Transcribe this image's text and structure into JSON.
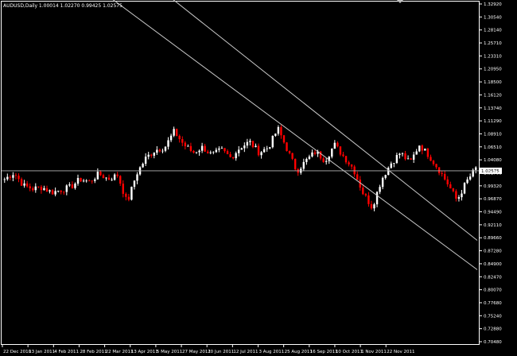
{
  "chart_data": {
    "type": "candlestick",
    "title": "AUDUSD,Daily  1.00014 1.02270 0.99425 1.02575",
    "current_price": "1.02575",
    "ylim": [
      0.7048,
      1.339
    ],
    "y_ticks": [
      "1.32920",
      "1.30540",
      "1.28140",
      "1.25710",
      "1.23310",
      "1.20950",
      "1.18500",
      "1.16120",
      "1.13740",
      "1.11290",
      "1.08910",
      "1.06510",
      "1.04080",
      "1.01700",
      "0.99320",
      "0.96870",
      "0.94490",
      "0.92110",
      "0.89660",
      "0.87280",
      "0.84900",
      "0.82470",
      "0.80070",
      "0.77680",
      "0.75240",
      "0.72880",
      "0.70480"
    ],
    "x_ticks": [
      "22 Dec 2010",
      "13 Jan 2011",
      "4 Feb 2011",
      "28 Feb 2011",
      "22 Mar 2011",
      "13 Apr 2011",
      "5 May 2011",
      "27 May 2011",
      "20 Jun 2011",
      "12 Jul 2011",
      "3 Aug 2011",
      "25 Aug 2011",
      "16 Sep 2011",
      "10 Oct 2011",
      "1 Nov 2011",
      "22 Nov 2011"
    ],
    "colors": {
      "background": "#000000",
      "up": "#ffffff",
      "down": "#ff0000",
      "grid": "#ffffff",
      "trendline": "#c8c8c8"
    },
    "anchor_closes": [
      1.01,
      1.022,
      0.998,
      0.992,
      0.995,
      0.985,
      0.99,
      0.995,
      1.01,
      1.005,
      1.02,
      1.01,
      1.018,
      0.965,
      1.02,
      1.05,
      1.065,
      1.07,
      1.1,
      1.075,
      1.06,
      1.07,
      1.055,
      1.065,
      1.05,
      1.07,
      1.08,
      1.06,
      1.07,
      1.105,
      1.065,
      1.025,
      1.045,
      1.062,
      1.045,
      1.075,
      1.052,
      1.03,
      0.985,
      0.957,
      1.01,
      1.04,
      1.06,
      1.04,
      1.075,
      1.055,
      1.03,
      1.002,
      0.97,
      1.005,
      1.03
    ],
    "trend_lines": [
      {
        "x1": 0,
        "y1": 1.5,
        "x2": 168,
        "y2": 0.84
      },
      {
        "x1": 0,
        "y1": 1.6,
        "x2": 168,
        "y2": 0.895
      }
    ],
    "grid": false
  }
}
